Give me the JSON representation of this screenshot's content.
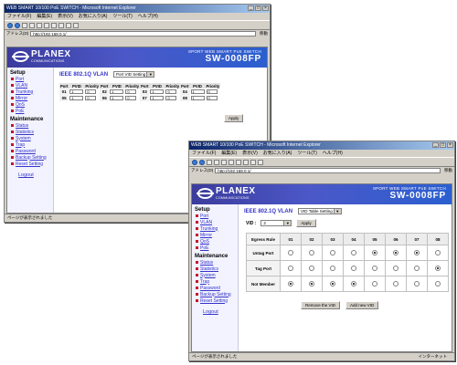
{
  "browser": {
    "title": "WEB SMART 10/100 PoE SWITCH - Microsoft Internet Explorer",
    "menu": [
      "ファイル(F)",
      "編集(E)",
      "表示(V)",
      "お気に入り(A)",
      "ツール(T)",
      "ヘルプ(H)"
    ],
    "address_label": "アドレス(D)",
    "go_label": "移動",
    "status": "ページが表示されました",
    "zone": "インターネット"
  },
  "brand": {
    "logo": "PLANEX",
    "logo_sub": "COMMUNICATIONS",
    "subtitle": "8PORT WEB SMART PoE SWITCH",
    "model": "SW-0008FP"
  },
  "sidebar": {
    "setup_heading": "Setup",
    "setup_items": [
      "Port",
      "VLAN",
      "Trunking",
      "Mirror",
      "QoS",
      "PoE"
    ],
    "maintenance_heading": "Maintenance",
    "maintenance_items": [
      "Status",
      "Statistics",
      "System",
      "Trap",
      "Password",
      "Backup Setting",
      "Reset Setting"
    ],
    "logout": "Logout"
  },
  "back": {
    "url": "http://192.168.0.1/",
    "page_title": "IEEE 802.1Q VLAN",
    "mode_select": "Port VID Setting",
    "headers": [
      "Port",
      "PVID",
      "Priority",
      "Port",
      "PVID",
      "Priority",
      "Port",
      "PVID",
      "Priority",
      "Port",
      "PVID",
      "Priority"
    ],
    "rows": [
      [
        {
          "port": "01",
          "pvid": "1",
          "priority": "0"
        },
        {
          "port": "02",
          "pvid": "1",
          "priority": "0"
        },
        {
          "port": "03",
          "pvid": "1",
          "priority": "0"
        },
        {
          "port": "04",
          "pvid": "1",
          "priority": "0"
        }
      ],
      [
        {
          "port": "05",
          "pvid": "1",
          "priority": "0"
        },
        {
          "port": "06",
          "pvid": "1",
          "priority": "0"
        },
        {
          "port": "07",
          "pvid": "1",
          "priority": "0"
        },
        {
          "port": "08",
          "pvid": "1",
          "priority": "0"
        }
      ]
    ],
    "apply": "Apply"
  },
  "front": {
    "url": "http://192.168.0.1/",
    "page_title": "IEEE 802.1Q VLAN",
    "mode_select": "VID Table Setting",
    "vid_label": "VID :",
    "vid_value": "2",
    "apply": "Apply",
    "columns": [
      "Egress Rule",
      "01",
      "02",
      "03",
      "04",
      "05",
      "06",
      "07",
      "08"
    ],
    "rules": [
      {
        "label": "Untag Port",
        "selected": [
          false,
          false,
          false,
          false,
          true,
          true,
          true,
          false
        ]
      },
      {
        "label": "Tag Port",
        "selected": [
          false,
          false,
          false,
          false,
          false,
          false,
          false,
          true
        ]
      },
      {
        "label": "Not Member",
        "selected": [
          true,
          true,
          true,
          true,
          false,
          false,
          false,
          false
        ]
      }
    ],
    "remove_button": "Remove the VID",
    "add_button": "Add new VID"
  }
}
